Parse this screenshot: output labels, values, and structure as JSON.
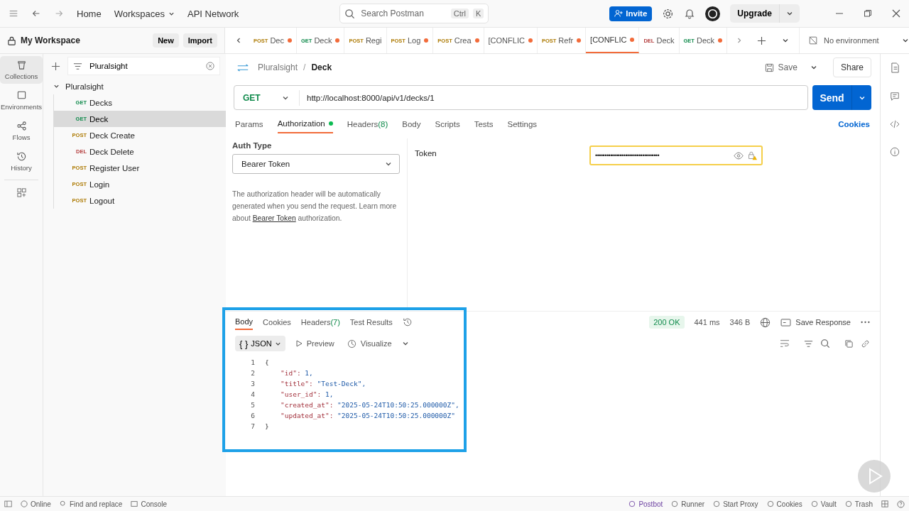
{
  "topbar": {
    "nav": [
      "Home",
      "Workspaces",
      "API Network"
    ],
    "search_placeholder": "Search Postman",
    "shortcut": [
      "Ctrl",
      "K"
    ],
    "invite": "Invite",
    "upgrade": "Upgrade"
  },
  "workspace": {
    "title": "My Workspace",
    "buttons": [
      "New",
      "Import"
    ]
  },
  "tabs": [
    {
      "method": "POST",
      "label": "Dec",
      "dirty": true,
      "selected": false
    },
    {
      "method": "GET",
      "label": "Deck",
      "dirty": true,
      "selected": false
    },
    {
      "method": "POST",
      "label": "Regi",
      "dirty": false,
      "selected": false
    },
    {
      "method": "POST",
      "label": "Log",
      "dirty": true,
      "selected": false
    },
    {
      "method": "POST",
      "label": "Crea",
      "dirty": true,
      "selected": false
    },
    {
      "label": "[CONFLIC",
      "dirty": true,
      "selected": false
    },
    {
      "method": "POST",
      "label": "Refr",
      "dirty": true,
      "selected": false
    },
    {
      "label": "[CONFLIC",
      "dirty": true,
      "selected": true
    },
    {
      "method": "DEL",
      "label": "Deck",
      "dirty": false,
      "selected": false
    },
    {
      "method": "GET",
      "label": "Deck",
      "dirty": true,
      "selected": false
    }
  ],
  "environment": "No environment",
  "rail": [
    {
      "label": "Collections",
      "selected": true
    },
    {
      "label": "Environments",
      "selected": false
    },
    {
      "label": "Flows",
      "selected": false
    },
    {
      "label": "History",
      "selected": false
    }
  ],
  "filter": "Pluralsight",
  "tree": [
    {
      "name": "Pluralsight",
      "expanded": true,
      "children": [
        {
          "method": "GET",
          "name": "Decks",
          "selected": false
        },
        {
          "method": "GET",
          "name": "Deck",
          "selected": true
        },
        {
          "method": "POST",
          "name": "Deck Create",
          "selected": false
        },
        {
          "method": "DEL",
          "name": "Deck Delete",
          "selected": false
        },
        {
          "method": "POST",
          "name": "Register User",
          "selected": false
        },
        {
          "method": "POST",
          "name": "Login",
          "selected": false
        },
        {
          "method": "POST",
          "name": "Logout",
          "selected": false
        }
      ]
    }
  ],
  "request": {
    "breadcrumb": [
      "Pluralsight",
      "/",
      "Deck"
    ],
    "save": "Save",
    "share": "Share",
    "method": "GET",
    "url": "http://localhost:8000/api/v1/decks/1",
    "send": "Send",
    "tabs": [
      {
        "label": "Params",
        "selected": false
      },
      {
        "label": "Authorization",
        "selected": true,
        "dot": true
      },
      {
        "label": "Headers",
        "count": "(8)",
        "selected": false
      },
      {
        "label": "Body",
        "selected": false
      },
      {
        "label": "Scripts",
        "selected": false
      },
      {
        "label": "Tests",
        "selected": false
      },
      {
        "label": "Settings",
        "selected": false
      }
    ],
    "cookies": "Cookies",
    "auth_type_label": "Auth Type",
    "auth_type": "Bearer Token",
    "auth_help": "The authorization header will be automatically generated when you send the request. Learn more about",
    "auth_link": "Bearer Token",
    "auth_help_end": "authorization.",
    "token_label": "Token",
    "token": "••••••••••••••••••••••••••••••••••"
  },
  "response": {
    "tabs": [
      {
        "label": "Body",
        "selected": true
      },
      {
        "label": "Cookies",
        "selected": false
      },
      {
        "label": "Headers",
        "count": "(7)",
        "selected": false
      },
      {
        "label": "Test Results",
        "selected": false
      }
    ],
    "status": "200 OK",
    "time": "441 ms",
    "size": "346 B",
    "save_response": "Save Response",
    "format_icon": "{ }",
    "format": "JSON",
    "preview": "Preview",
    "visualize": "Visualize",
    "lines": [
      {
        "num": "1",
        "text": "{"
      },
      {
        "num": "2",
        "key": "\"id\":",
        "value": "1,"
      },
      {
        "num": "3",
        "key": "\"title\":",
        "value": "\"Test-Deck\","
      },
      {
        "num": "4",
        "key": "\"user_id\":",
        "value": "1,"
      },
      {
        "num": "5",
        "key": "\"created_at\":",
        "value": "\"2025-05-24T10:50:25.000000Z\","
      },
      {
        "num": "6",
        "key": "\"updated_at\":",
        "value": "\"2025-05-24T10:50:25.000000Z\""
      },
      {
        "num": "7",
        "text": "}"
      }
    ]
  },
  "status_bar": {
    "left": [
      "Online",
      "Find and replace",
      "Console"
    ],
    "right": [
      "Postbot",
      "Runner",
      "Start Proxy",
      "Cookies",
      "Vault",
      "Trash"
    ]
  }
}
